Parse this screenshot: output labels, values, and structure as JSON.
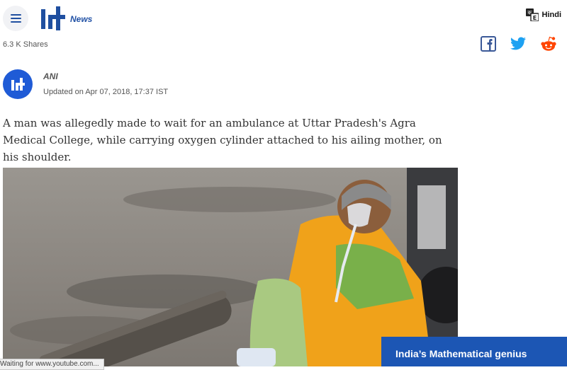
{
  "header": {
    "brand_label": "News",
    "language_label": "Hindi"
  },
  "shares": {
    "count_label": "6.3 K Shares",
    "buttons": [
      "facebook-icon",
      "twitter-icon",
      "reddit-icon"
    ]
  },
  "byline": {
    "author": "ANI",
    "updated": "Updated on Apr 07, 2018, 17:37 IST"
  },
  "article": {
    "lede": "A man was allegedly made to wait for an ambulance at Uttar Pradesh's Agra Medical College, while carrying oxygen cylinder attached to his ailing mother, on his shoulder."
  },
  "status_bar": {
    "text": "Waiting for www.youtube.com..."
  },
  "promo": {
    "label": "India’s Mathematical genius"
  },
  "colors": {
    "brand_blue": "#1f5bd6",
    "promo_blue": "#1c56b4",
    "facebook": "#3b5998",
    "twitter": "#1da1f2",
    "reddit": "#ff4500"
  }
}
